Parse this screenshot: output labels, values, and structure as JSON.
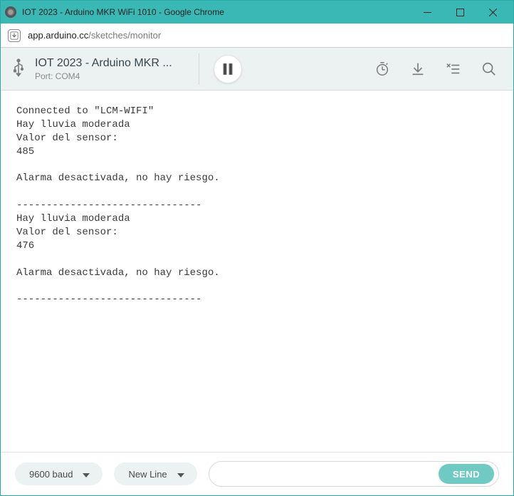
{
  "window": {
    "title": "IOT 2023 - Arduino MKR WiFi 1010 - Google Chrome"
  },
  "address": {
    "host": "app.arduino.cc",
    "path": "/sketches/monitor"
  },
  "toolbar": {
    "sketch_name": "IOT 2023 - Arduino MKR ...",
    "port_label": "Port: COM4"
  },
  "monitor_output": "Connected to \"LCM-WIFI\"\nHay lluvia moderada\nValor del sensor:\n485\n\nAlarma desactivada, no hay riesgo.\n\n-------------------------------\nHay lluvia moderada\nValor del sensor:\n476\n\nAlarma desactivada, no hay riesgo.\n\n-------------------------------",
  "footer": {
    "baud_label": "9600 baud",
    "line_ending_label": "New Line",
    "input_value": "",
    "input_placeholder": "",
    "send_label": "SEND"
  }
}
